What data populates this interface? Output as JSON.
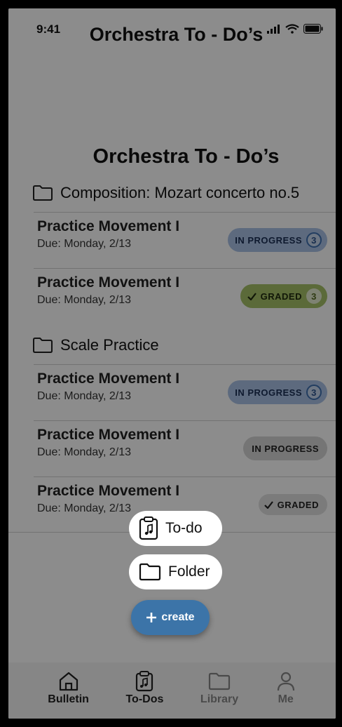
{
  "status": {
    "time": "9:41"
  },
  "header": {
    "title": "Orchestra To - Do’s"
  },
  "page": {
    "title": "Orchestra To - Do’s"
  },
  "folders": [
    {
      "name": "Composition: Mozart concerto no.5",
      "items": [
        {
          "title": "Practice Movement I",
          "due": "Due: Monday, 2/13",
          "status": "IN PROGRESS",
          "count": "3",
          "style": "blue"
        },
        {
          "title": "Practice Movement I",
          "due": "Due: Monday, 2/13",
          "status": "GRADED",
          "count": "3",
          "style": "green"
        }
      ]
    },
    {
      "name": "Scale Practice",
      "items": [
        {
          "title": "Practice Movement I",
          "due": "Due: Monday, 2/13",
          "status": "IN PROGRESS",
          "count": "3",
          "style": "blue"
        },
        {
          "title": "Practice Movement I",
          "due": "Due: Monday, 2/13",
          "status": "IN PROGRESS",
          "style": "gray"
        },
        {
          "title": "Practice Movement I",
          "due": "Due: Monday, 2/13",
          "status": "GRADED",
          "style": "light"
        }
      ]
    }
  ],
  "menu": {
    "todo_label": "To-do",
    "folder_label": "Folder",
    "create_label": "create"
  },
  "tabbar": [
    {
      "label": "Bulletin",
      "icon": "home-icon"
    },
    {
      "label": "To-Dos",
      "icon": "clipboard-music-icon"
    },
    {
      "label": "Library",
      "icon": "folder-icon"
    },
    {
      "label": "Me",
      "icon": "person-icon"
    }
  ],
  "colors": {
    "accent": "#3c74a8",
    "in_progress": "#a9c2e6",
    "graded": "#a6c169",
    "overlay": "rgba(0,0,0,0.45)"
  }
}
